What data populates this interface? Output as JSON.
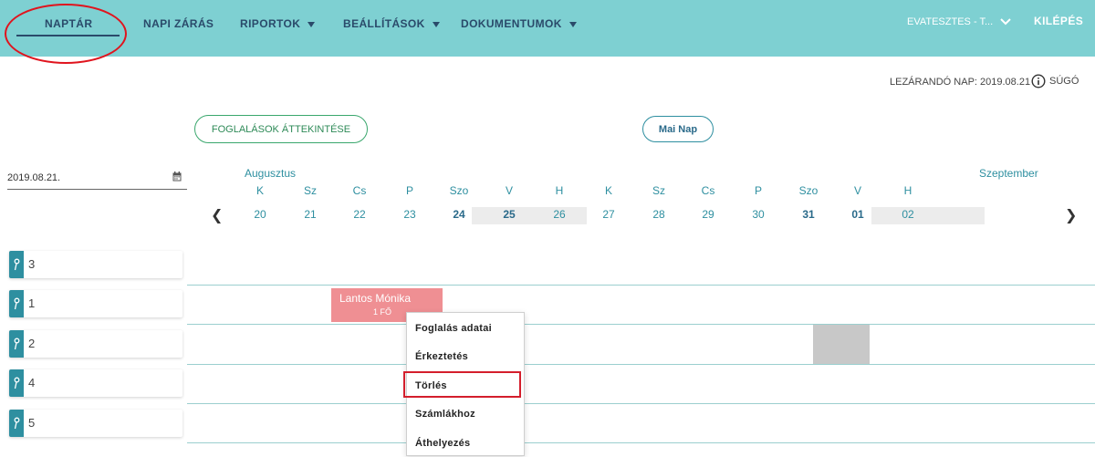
{
  "nav": {
    "items": [
      {
        "label": "NAPTÁR"
      },
      {
        "label": "NAPI ZÁRÁS"
      },
      {
        "label": "RIPORTOK"
      },
      {
        "label": "BEÁLLÍTÁSOK"
      },
      {
        "label": "DOKUMENTUMOK"
      }
    ],
    "user": "EVATESZTES - T...",
    "logout": "KILÉPÉS"
  },
  "info": {
    "close_day": "LEZÁRANDÓ NAP: 2019.08.21",
    "help": "SÚGÓ"
  },
  "buttons": {
    "overview": "FOGLALÁSOK ÁTTEKINTÉSE",
    "today": "Mai Nap"
  },
  "date_input": {
    "value": "2019.08.21."
  },
  "calendar": {
    "months": [
      "Augusztus",
      "Szeptember"
    ],
    "days": [
      {
        "dow": "K",
        "num": "20"
      },
      {
        "dow": "Sz",
        "num": "21"
      },
      {
        "dow": "Cs",
        "num": "22"
      },
      {
        "dow": "P",
        "num": "23"
      },
      {
        "dow": "Szo",
        "num": "24"
      },
      {
        "dow": "V",
        "num": "25"
      },
      {
        "dow": "H",
        "num": "26"
      },
      {
        "dow": "K",
        "num": "27"
      },
      {
        "dow": "Sz",
        "num": "28"
      },
      {
        "dow": "Cs",
        "num": "29"
      },
      {
        "dow": "P",
        "num": "30"
      },
      {
        "dow": "Szo",
        "num": "31"
      },
      {
        "dow": "V",
        "num": "01"
      },
      {
        "dow": "H",
        "num": "02"
      }
    ]
  },
  "rooms": [
    {
      "label": "3"
    },
    {
      "label": "1"
    },
    {
      "label": "2"
    },
    {
      "label": "4"
    },
    {
      "label": "5"
    }
  ],
  "booking": {
    "name": "Lantos Mónika",
    "count": "1 FŐ"
  },
  "context_menu": {
    "items": [
      {
        "label": "Foglalás adatai"
      },
      {
        "label": "Érkeztetés"
      },
      {
        "label": "Törlés"
      },
      {
        "label": "Számlákhoz"
      },
      {
        "label": "Áthelyezés"
      }
    ]
  },
  "colors": {
    "header": "#7ed0d2",
    "accent": "#2e8fa0",
    "booking": "#ef8f93",
    "annotation": "#e0141e"
  }
}
